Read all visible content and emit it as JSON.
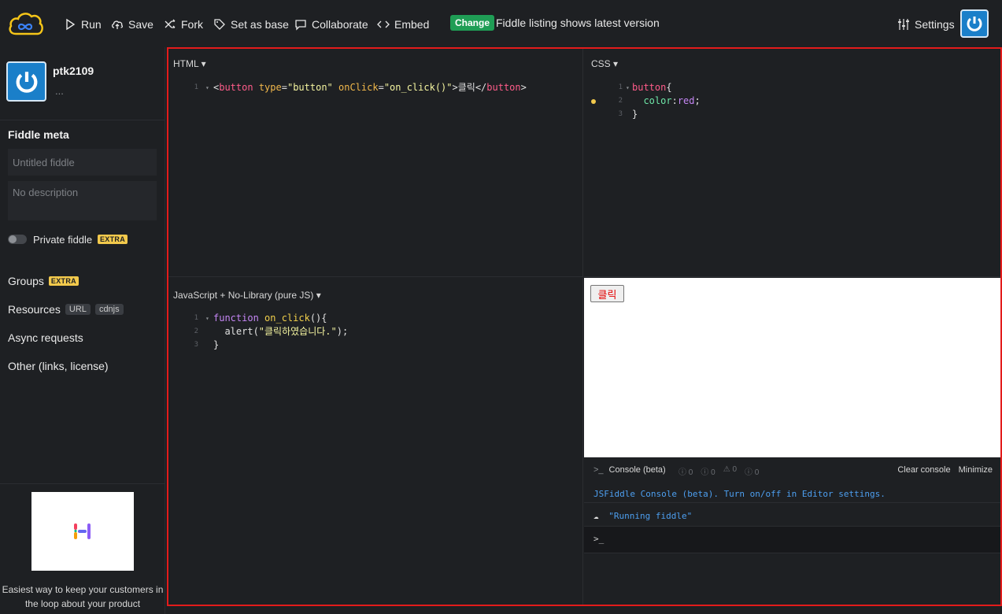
{
  "topbar": {
    "run_label": "Run",
    "save_label": "Save",
    "fork_label": "Fork",
    "set_base_label": "Set as base",
    "collaborate_label": "Collaborate",
    "embed_label": "Embed",
    "change_badge": "Change",
    "change_text": "Fiddle listing shows latest version",
    "settings_label": "Settings"
  },
  "sidebar": {
    "username": "ptk2109",
    "user_sub": "...",
    "meta_title": "Fiddle meta",
    "title_placeholder": "Untitled fiddle",
    "description_placeholder": "No description",
    "private_label": "Private fiddle",
    "extra_badge": "EXTRA",
    "groups_label": "Groups",
    "groups_extra": "EXTRA",
    "resources_label": "Resources",
    "resources_tags": [
      "URL",
      "cdnjs"
    ],
    "async_label": "Async requests",
    "other_label": "Other (links, license)",
    "ad_text": "Easiest way to keep your customers in the loop about your product"
  },
  "panels": {
    "html_label": "HTML",
    "css_label": "CSS",
    "js_label": "JavaScript + No-Library (pure JS)",
    "html_code": [
      {
        "n": "1",
        "parts": [
          [
            "t-plain",
            "<"
          ],
          [
            "t-tag",
            "button"
          ],
          [
            "t-plain",
            " "
          ],
          [
            "t-attr",
            "type"
          ],
          [
            "t-plain",
            "="
          ],
          [
            "t-str",
            "\"button\""
          ],
          [
            "t-plain",
            " "
          ],
          [
            "t-attr",
            "onClick"
          ],
          [
            "t-plain",
            "="
          ],
          [
            "t-str",
            "\"on_click()\""
          ],
          [
            "t-plain",
            ">클릭</"
          ],
          [
            "t-tag",
            "button"
          ],
          [
            "t-plain",
            ">"
          ]
        ]
      }
    ],
    "css_code": [
      {
        "n": "1",
        "parts": [
          [
            "t-tag",
            "button"
          ],
          [
            "t-plain",
            "{"
          ]
        ]
      },
      {
        "n": "2",
        "parts": [
          [
            "t-plain",
            "  "
          ],
          [
            "t-prop",
            "color"
          ],
          [
            "t-plain",
            ":"
          ],
          [
            "t-val",
            "red"
          ],
          [
            "t-plain",
            ";"
          ]
        ]
      },
      {
        "n": "3",
        "parts": [
          [
            "t-plain",
            "}"
          ]
        ]
      }
    ],
    "js_code": [
      {
        "n": "1",
        "parts": [
          [
            "t-kw",
            "function"
          ],
          [
            "t-plain",
            " "
          ],
          [
            "t-fn",
            "on_click"
          ],
          [
            "t-plain",
            "(){"
          ]
        ]
      },
      {
        "n": "2",
        "parts": [
          [
            "t-plain",
            "  alert("
          ],
          [
            "t-str",
            "\"클릭하였습니다.\""
          ],
          [
            "t-plain",
            ");"
          ]
        ]
      },
      {
        "n": "3",
        "parts": [
          [
            "t-plain",
            "}"
          ]
        ]
      }
    ]
  },
  "result": {
    "button_label": "클릭"
  },
  "console": {
    "title": "Console (beta)",
    "counters": [
      "0",
      "0",
      "0",
      "0"
    ],
    "clear_label": "Clear console",
    "minimize_label": "Minimize",
    "info_line": "JSFiddle Console (beta). Turn on/off in Editor settings.",
    "log_line": "\"Running fiddle\"",
    "prompt": ">_"
  },
  "colors": {
    "background": "#1e2023",
    "accent_red": "#e31b1b",
    "change_green": "#1f9d55",
    "extra_yellow": "#f2c94c",
    "avatar_blue": "#1a7fc9"
  }
}
